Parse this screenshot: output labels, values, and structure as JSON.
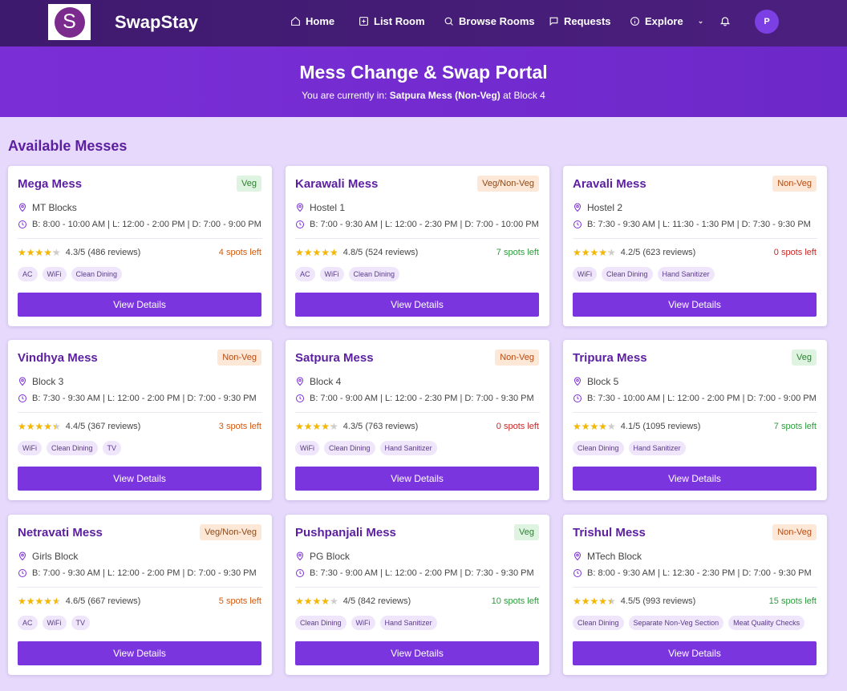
{
  "nav": {
    "logo_letter": "S",
    "brand": "SwapStay",
    "items": [
      {
        "label": "Home",
        "icon": "home-icon"
      },
      {
        "label": "List Room",
        "icon": "plus-square-icon"
      },
      {
        "label": "Browse Rooms",
        "icon": "search-icon"
      },
      {
        "label": "Requests",
        "icon": "message-icon"
      },
      {
        "label": "Explore",
        "icon": "info-icon"
      }
    ],
    "avatar": "P"
  },
  "hero": {
    "title": "Mess Change & Swap Portal",
    "prefix": "You are currently in: ",
    "current_mess": "Satpura Mess (Non-Veg)",
    "suffix": " at Block 4"
  },
  "section_title": "Available Messes",
  "button_label": "View Details",
  "messes": [
    {
      "name": "Mega Mess",
      "type": "Veg",
      "type_class": "veg",
      "location": "MT Blocks",
      "timing": "B: 8:00 - 10:00 AM | L: 12:00 - 2:00 PM | D: 7:00 - 9:00 PM",
      "rating": 4.3,
      "rating_text": "4.3/5 (486 reviews)",
      "spots": "4 spots left",
      "spots_class": "orange",
      "tags": [
        "AC",
        "WiFi",
        "Clean Dining"
      ]
    },
    {
      "name": "Karawali Mess",
      "type": "Veg/Non-Veg",
      "type_class": "both",
      "location": "Hostel 1",
      "timing": "B: 7:00 - 9:30 AM | L: 12:00 - 2:30 PM | D: 7:00 - 10:00 PM",
      "rating": 4.8,
      "rating_text": "4.8/5 (524 reviews)",
      "spots": "7 spots left",
      "spots_class": "green",
      "tags": [
        "AC",
        "WiFi",
        "Clean Dining"
      ]
    },
    {
      "name": "Aravali Mess",
      "type": "Non-Veg",
      "type_class": "nonveg",
      "location": "Hostel 2",
      "timing": "B: 7:30 - 9:30 AM | L: 11:30 - 1:30 PM | D: 7:30 - 9:30 PM",
      "rating": 4.2,
      "rating_text": "4.2/5 (623 reviews)",
      "spots": "0 spots left",
      "spots_class": "red",
      "tags": [
        "WiFi",
        "Clean Dining",
        "Hand Sanitizer"
      ]
    },
    {
      "name": "Vindhya Mess",
      "type": "Non-Veg",
      "type_class": "nonveg",
      "location": "Block 3",
      "timing": "B: 7:30 - 9:30 AM | L: 12:00 - 2:00 PM | D: 7:00 - 9:30 PM",
      "rating": 4.4,
      "rating_text": "4.4/5 (367 reviews)",
      "spots": "3 spots left",
      "spots_class": "orange",
      "tags": [
        "WiFi",
        "Clean Dining",
        "TV"
      ]
    },
    {
      "name": "Satpura Mess",
      "type": "Non-Veg",
      "type_class": "nonveg",
      "location": "Block 4",
      "timing": "B: 7:00 - 9:00 AM | L: 12:00 - 2:30 PM | D: 7:00 - 9:30 PM",
      "rating": 4.3,
      "rating_text": "4.3/5 (763 reviews)",
      "spots": "0 spots left",
      "spots_class": "red",
      "tags": [
        "WiFi",
        "Clean Dining",
        "Hand Sanitizer"
      ]
    },
    {
      "name": "Tripura Mess",
      "type": "Veg",
      "type_class": "veg",
      "location": "Block 5",
      "timing": "B: 7:30 - 10:00 AM | L: 12:00 - 2:00 PM | D: 7:00 - 9:00 PM",
      "rating": 4.1,
      "rating_text": "4.1/5 (1095 reviews)",
      "spots": "7 spots left",
      "spots_class": "green",
      "tags": [
        "Clean Dining",
        "Hand Sanitizer"
      ]
    },
    {
      "name": "Netravati Mess",
      "type": "Veg/Non-Veg",
      "type_class": "both",
      "location": "Girls Block",
      "timing": "B: 7:00 - 9:30 AM | L: 12:00 - 2:00 PM | D: 7:00 - 9:30 PM",
      "rating": 4.6,
      "rating_text": "4.6/5 (667 reviews)",
      "spots": "5 spots left",
      "spots_class": "orange",
      "tags": [
        "AC",
        "WiFi",
        "TV"
      ]
    },
    {
      "name": "Pushpanjali Mess",
      "type": "Veg",
      "type_class": "veg",
      "location": "PG Block",
      "timing": "B: 7:30 - 9:00 AM | L: 12:00 - 2:00 PM | D: 7:30 - 9:30 PM",
      "rating": 4.0,
      "rating_text": "4/5 (842 reviews)",
      "spots": "10 spots left",
      "spots_class": "green",
      "tags": [
        "Clean Dining",
        "WiFi",
        "Hand Sanitizer"
      ]
    },
    {
      "name": "Trishul Mess",
      "type": "Non-Veg",
      "type_class": "nonveg",
      "location": "MTech Block",
      "timing": "B: 8:00 - 9:30 AM | L: 12:30 - 2:30 PM | D: 7:00 - 9:30 PM",
      "rating": 4.5,
      "rating_text": "4.5/5 (993 reviews)",
      "spots": "15 spots left",
      "spots_class": "green",
      "tags": [
        "Clean Dining",
        "Separate Non-Veg Section",
        "Meat Quality Checks"
      ]
    }
  ]
}
